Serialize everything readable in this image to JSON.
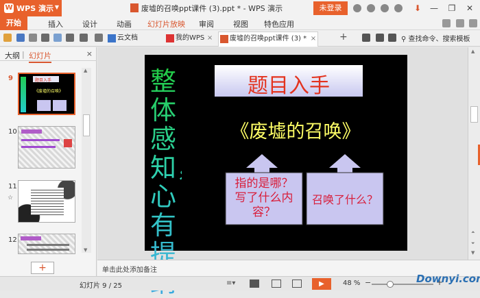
{
  "app": {
    "name": "WPS 演示",
    "doc_title": "废墟的召唤ppt课件 (3).ppt * - WPS 演示",
    "login_label": "未登录"
  },
  "menu": {
    "items": [
      "开始",
      "插入",
      "设计",
      "动画",
      "幻灯片放映",
      "审阅",
      "视图",
      "特色应用"
    ],
    "active_index": 4
  },
  "tabs": {
    "items": [
      {
        "label": "云文档"
      },
      {
        "label": "我的WPS"
      },
      {
        "label": "废墟的召唤ppt课件 (3) *"
      }
    ],
    "search_placeholder": "查找命令、搜索模板"
  },
  "leftpane": {
    "tab_outline": "大纲",
    "tab_slides": "幻灯片",
    "close": "×",
    "slides": [
      {
        "num": "9"
      },
      {
        "num": "10"
      },
      {
        "num": "11"
      },
      {
        "num": "12"
      }
    ],
    "add_label": "+"
  },
  "slide": {
    "vertical_text": "整体感知，心有提纲",
    "title": "题目入手",
    "book_title": "《废墟的召唤》",
    "box_left": "指的是哪？写了什么内容？",
    "box_right": "召唤了什么？"
  },
  "notes": {
    "placeholder": "单击此处添加备注"
  },
  "status": {
    "slide_counter": "幻灯片 9 / 25",
    "zoom": "48 %",
    "zoom_level": 0.48
  },
  "watermark": "Downyi.com",
  "colors": {
    "accent": "#e8612c",
    "slide_bg": "#000000",
    "title_text": "#e3331f",
    "book_title": "#ffff66",
    "box_fill": "#c9c6f0"
  }
}
